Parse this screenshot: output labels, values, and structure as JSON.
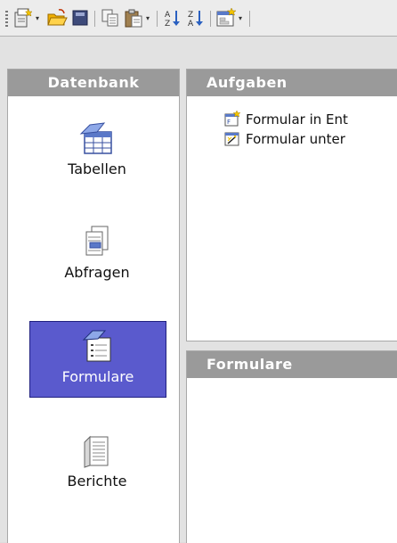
{
  "toolbar": {
    "icons": [
      "wizard-icon",
      "open-folder-icon",
      "database-object-icon",
      "copy-icon",
      "paste-icon",
      "sort-ascending-icon",
      "sort-descending-icon",
      "new-form-icon"
    ],
    "dropdown_arrow": "▾"
  },
  "database_panel": {
    "title": "Datenbank",
    "items": [
      {
        "label": "Tabellen",
        "icon": "tables-icon",
        "selected": false
      },
      {
        "label": "Abfragen",
        "icon": "queries-icon",
        "selected": false
      },
      {
        "label": "Formulare",
        "icon": "forms-icon",
        "selected": true
      },
      {
        "label": "Berichte",
        "icon": "reports-icon",
        "selected": false
      }
    ]
  },
  "tasks_panel": {
    "title": "Aufgaben",
    "tasks": [
      {
        "label": "Formular in Ent",
        "icon": "form-design-icon"
      },
      {
        "label": "Formular unter",
        "icon": "form-wizard-icon"
      }
    ]
  },
  "forms_panel": {
    "title": "Formulare"
  },
  "colors": {
    "header_bg": "#9a9a9a",
    "selected_bg": "#5a5acd",
    "panel_bg": "#ffffff",
    "frame_bg": "#e2e2e2"
  }
}
